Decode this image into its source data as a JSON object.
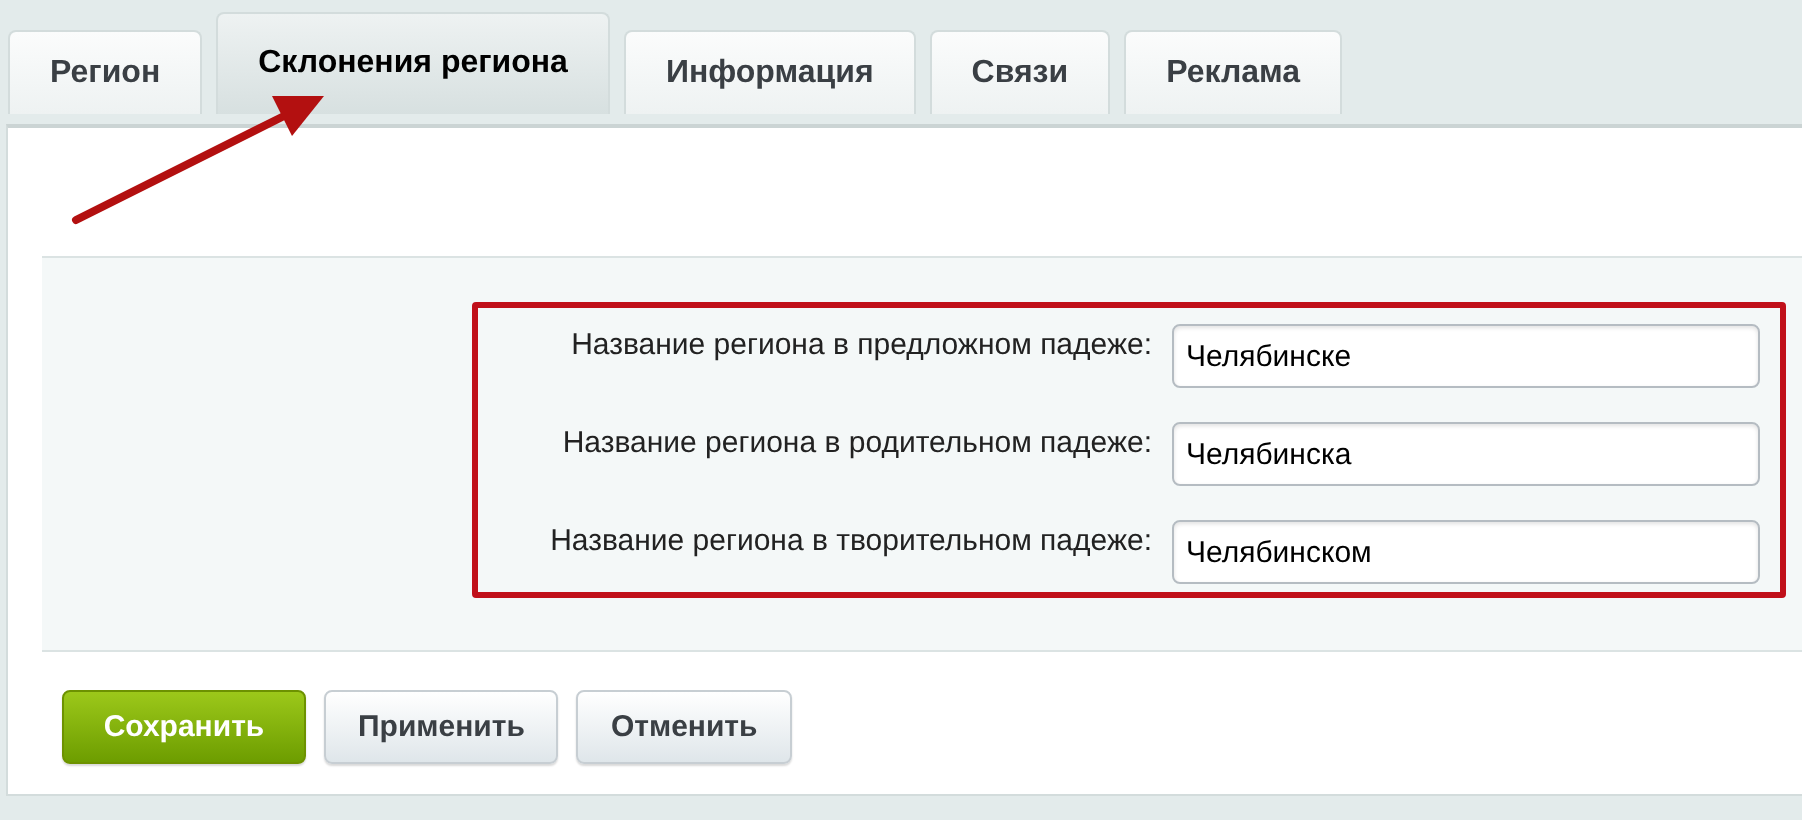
{
  "tabs": [
    {
      "label": "Регион",
      "selected": false
    },
    {
      "label": "Склонения региона",
      "selected": true
    },
    {
      "label": "Информация",
      "selected": false
    },
    {
      "label": "Связи",
      "selected": false
    },
    {
      "label": "Реклама",
      "selected": false
    }
  ],
  "fields": [
    {
      "label": "Название региона в предложном падеже:",
      "value": "Челябинске"
    },
    {
      "label": "Название региона в родительном падеже:",
      "value": "Челябинска"
    },
    {
      "label": "Название региона в творительном падеже:",
      "value": "Челябинском"
    }
  ],
  "buttons": [
    {
      "label": "Сохранить",
      "kind": "primary"
    },
    {
      "label": "Применить",
      "kind": "default"
    },
    {
      "label": "Отменить",
      "kind": "default"
    }
  ]
}
